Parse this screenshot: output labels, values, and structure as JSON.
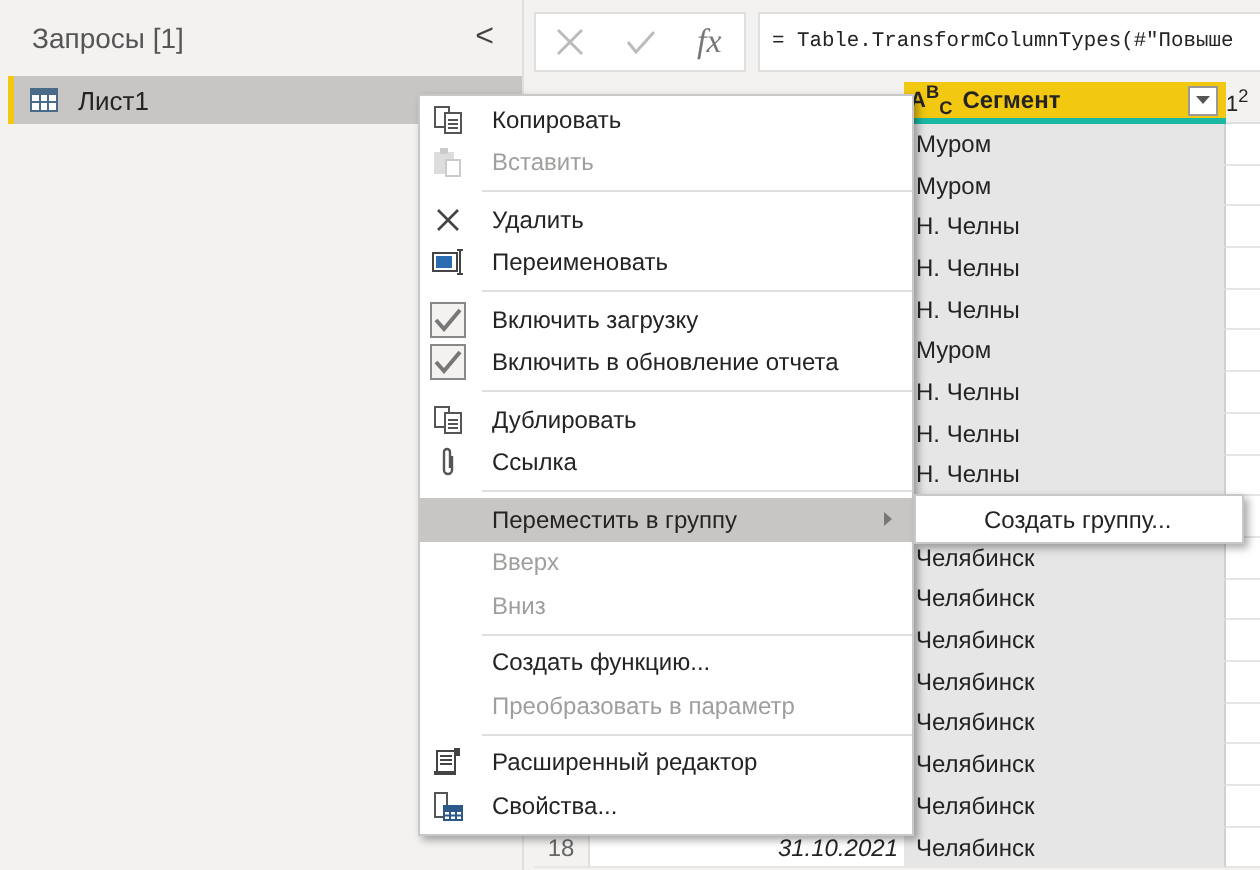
{
  "sidebar": {
    "title": "Запросы [1]",
    "collapse": "<",
    "items": [
      {
        "label": "Лист1",
        "selected": true
      }
    ]
  },
  "formula_bar": {
    "fx": "fx",
    "formula": "= Table.TransformColumnTypes(#\"Повыше"
  },
  "table": {
    "columns": [
      {
        "type_label": "A$^{B}$$_{C}$",
        "title": "Сегмент",
        "selected": true
      },
      {
        "type_label": "1$^{2}$",
        "selected": false
      }
    ],
    "rows": [
      {
        "segment": "Муром"
      },
      {
        "segment": "Муром"
      },
      {
        "segment": "Н. Челны"
      },
      {
        "segment": "Н. Челны"
      },
      {
        "segment": "Н. Челны"
      },
      {
        "segment": "Муром"
      },
      {
        "segment": "Н. Челны"
      },
      {
        "segment": "Н. Челны"
      },
      {
        "segment": "Н. Челны"
      },
      {},
      {
        "segment": "Челябинск"
      },
      {
        "segment": "Челябинск"
      },
      {
        "segment": "Челябинск"
      },
      {
        "segment": "Челябинск"
      },
      {
        "segment": "Челябинск"
      },
      {
        "segment": "Челябинск"
      },
      {
        "segment": "Челябинск"
      },
      {
        "number": "18",
        "date": "31.10.2021",
        "segment": "Челябинск"
      }
    ]
  },
  "context_menu": {
    "items": [
      {
        "kind": "item",
        "label": "Копировать",
        "disabled": false,
        "selected": false
      },
      {
        "kind": "item",
        "label": "Вставить",
        "disabled": true,
        "selected": false
      },
      {
        "kind": "separator"
      },
      {
        "kind": "item",
        "label": "Удалить",
        "disabled": false,
        "selected": false
      },
      {
        "kind": "item",
        "label": "Переименовать",
        "disabled": false,
        "selected": false
      },
      {
        "kind": "separator"
      },
      {
        "kind": "check",
        "label": "Включить загрузку",
        "checked": true,
        "disabled": false,
        "selected": false
      },
      {
        "kind": "check",
        "label": "Включить в обновление отчета",
        "checked": true,
        "disabled": false,
        "selected": false
      },
      {
        "kind": "separator"
      },
      {
        "kind": "item",
        "label": "Дублировать",
        "disabled": false,
        "selected": false
      },
      {
        "kind": "item",
        "label": "Ссылка",
        "disabled": false,
        "selected": false
      },
      {
        "kind": "separator"
      },
      {
        "kind": "submenu",
        "label": "Переместить в группу",
        "disabled": false,
        "selected": true,
        "submenu": [
          {
            "label": "Создать группу..."
          }
        ]
      },
      {
        "kind": "item",
        "label": "Вверх",
        "disabled": true,
        "selected": false
      },
      {
        "kind": "item",
        "label": "Вниз",
        "disabled": true,
        "selected": false
      },
      {
        "kind": "separator"
      },
      {
        "kind": "item",
        "label": "Создать функцию...",
        "disabled": false,
        "selected": false
      },
      {
        "kind": "item",
        "label": "Преобразовать в параметр",
        "disabled": true,
        "selected": false
      },
      {
        "kind": "separator"
      },
      {
        "kind": "item",
        "label": "Расширенный редактор",
        "disabled": false,
        "selected": false
      },
      {
        "kind": "item",
        "label": "Свойства...",
        "disabled": false,
        "selected": false
      }
    ]
  }
}
